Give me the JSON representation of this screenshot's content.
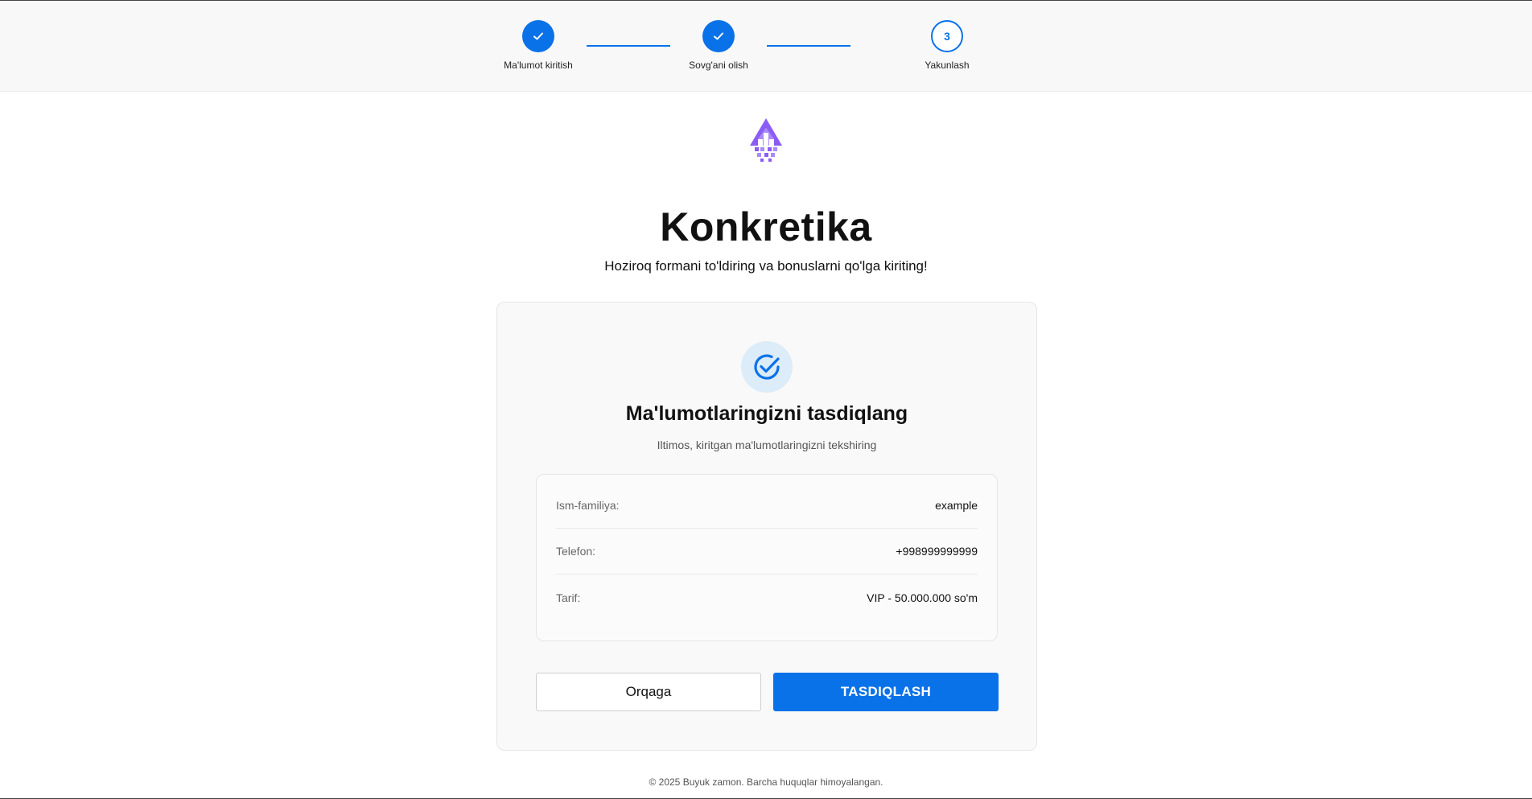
{
  "stepper": {
    "steps": [
      {
        "label": "Ma'lumot kiritish",
        "status": "done"
      },
      {
        "label": "Sovg'ani olish",
        "status": "done"
      },
      {
        "label": "Yakunlash",
        "status": "current",
        "number": "3"
      }
    ]
  },
  "brand": {
    "logo_icon": "rocket-arrow-logo-icon",
    "title": "Konkretika",
    "subtitle": "Hoziroq formani to'ldiring va bonuslarni qo'lga kiriting!"
  },
  "confirm_card": {
    "icon": "check-circle-icon",
    "title": "Ma'lumotlaringizni tasdiqlang",
    "subtitle": "Iltimos, kiritgan ma'lumotlaringizni tekshiring",
    "rows": [
      {
        "label": "Ism-familiya:",
        "value": "example"
      },
      {
        "label": "Telefon:",
        "value": "+998999999999"
      },
      {
        "label": "Tarif:",
        "value": "VIP - 50.000.000 so'm"
      }
    ],
    "back_label": "Orqaga",
    "confirm_label": "TASDIQLASH"
  },
  "footer": {
    "text": "© 2025 Buyuk zamon. Barcha huquqlar himoyalangan."
  },
  "colors": {
    "accent": "#0a72e8",
    "logo": "#8b5cf6",
    "badge_bg": "#dcecf9"
  }
}
